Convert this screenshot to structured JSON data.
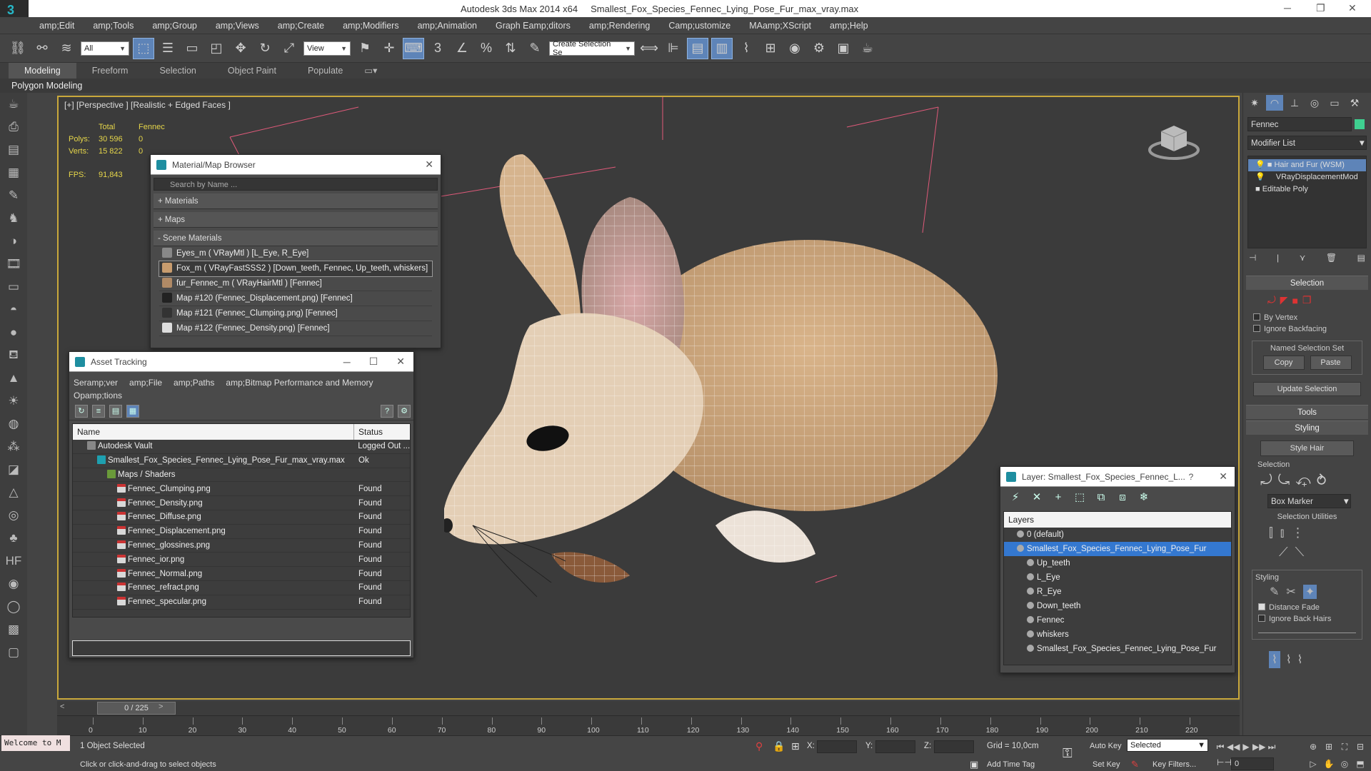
{
  "window": {
    "app_title": "Autodesk 3ds Max  2014 x64",
    "file_title": "Smallest_Fox_Species_Fennec_Lying_Pose_Fur_max_vray.max",
    "app_glyph": "3",
    "minimize": "─",
    "maximize": "❐",
    "close": "✕"
  },
  "menu": [
    "amp;Edit",
    "amp;Tools",
    "amp;Group",
    "amp;Views",
    "amp;Create",
    "amp;Modifiers",
    "amp;Animation",
    "Graph Eamp;ditors",
    "amp;Rendering",
    "Camp;ustomize",
    "MAamp;XScript",
    "amp;Help"
  ],
  "toolbar": {
    "filter_value": "All",
    "refcoord_value": "View",
    "selection_set_placeholder": "Create Selection Se"
  },
  "ribbon": {
    "tabs": [
      "Modeling",
      "Freeform",
      "Selection",
      "Object Paint",
      "Populate"
    ],
    "sub_label": "Polygon Modeling"
  },
  "viewport": {
    "label": "[+] [Perspective ] [Realistic + Edged Faces ]",
    "stats": {
      "head_total": "Total",
      "head_obj": "Fennec",
      "polys_label": "Polys:",
      "polys_total": "30 596",
      "polys_obj": "0",
      "verts_label": "Verts:",
      "verts_total": "15 822",
      "verts_obj": "0",
      "fps_label": "FPS:",
      "fps_value": "91,843"
    }
  },
  "material_browser": {
    "title": "Material/Map Browser",
    "search_placeholder": "Search by Name ...",
    "groups": [
      "+ Materials",
      "+ Maps",
      "- Scene Materials"
    ],
    "items": [
      "Eyes_m  ( VRayMtl ) [L_Eye, R_Eye]",
      "Fox_m  ( VRayFastSSS2 ) [Down_teeth, Fennec, Up_teeth, whiskers]",
      "fur_Fennec_m  ( VRayHairMtl ) [Fennec]",
      "Map #120 (Fennec_Displacement.png)  [Fennec]",
      "Map #121 (Fennec_Clumping.png)  [Fennec]",
      "Map #122 (Fennec_Density.png)  [Fennec]"
    ]
  },
  "asset_tracking": {
    "title": "Asset Tracking",
    "menu": [
      "Seramp;ver",
      "amp;File",
      "amp;Paths",
      "amp;Bitmap Performance and Memory"
    ],
    "menu2": "Opamp;tions",
    "col_name": "Name",
    "col_status": "Status",
    "rows": [
      {
        "name": "Autodesk Vault",
        "status": "Logged Out ...",
        "indent": 1,
        "icon": "vault"
      },
      {
        "name": "Smallest_Fox_Species_Fennec_Lying_Pose_Fur_max_vray.max",
        "status": "Ok",
        "indent": 2,
        "icon": "max"
      },
      {
        "name": "Maps / Shaders",
        "status": "",
        "indent": 3,
        "icon": "folder"
      },
      {
        "name": "Fennec_Clumping.png",
        "status": "Found",
        "indent": 4,
        "icon": "png"
      },
      {
        "name": "Fennec_Density.png",
        "status": "Found",
        "indent": 4,
        "icon": "png"
      },
      {
        "name": "Fennec_Diffuse.png",
        "status": "Found",
        "indent": 4,
        "icon": "png"
      },
      {
        "name": "Fennec_Displacement.png",
        "status": "Found",
        "indent": 4,
        "icon": "png"
      },
      {
        "name": "Fennec_glossines.png",
        "status": "Found",
        "indent": 4,
        "icon": "png"
      },
      {
        "name": "Fennec_ior.png",
        "status": "Found",
        "indent": 4,
        "icon": "png"
      },
      {
        "name": "Fennec_Normal.png",
        "status": "Found",
        "indent": 4,
        "icon": "png"
      },
      {
        "name": "Fennec_refract.png",
        "status": "Found",
        "indent": 4,
        "icon": "png"
      },
      {
        "name": "Fennec_specular.png",
        "status": "Found",
        "indent": 4,
        "icon": "png"
      }
    ]
  },
  "layer_panel": {
    "title": "Layer: Smallest_Fox_Species_Fennec_L...",
    "help": "?",
    "col": "Layers",
    "rows": [
      {
        "name": "0 (default)",
        "indent": 1,
        "selected": false
      },
      {
        "name": "Smallest_Fox_Species_Fennec_Lying_Pose_Fur",
        "indent": 1,
        "selected": true
      },
      {
        "name": "Up_teeth",
        "indent": 2,
        "selected": false
      },
      {
        "name": "L_Eye",
        "indent": 2,
        "selected": false
      },
      {
        "name": "R_Eye",
        "indent": 2,
        "selected": false
      },
      {
        "name": "Down_teeth",
        "indent": 2,
        "selected": false
      },
      {
        "name": "Fennec",
        "indent": 2,
        "selected": false
      },
      {
        "name": "whiskers",
        "indent": 2,
        "selected": false
      },
      {
        "name": "Smallest_Fox_Species_Fennec_Lying_Pose_Fur",
        "indent": 2,
        "selected": false
      }
    ]
  },
  "command_panel": {
    "object_name": "Fennec",
    "modifier_list": "Modifier List",
    "stack": [
      "Hair and Fur (WSM)",
      "VRayDisplacementMod",
      "Editable Poly"
    ],
    "selection_title": "Selection",
    "by_vertex": "By Vertex",
    "ignore_backfacing": "Ignore Backfacing",
    "named_sel_title": "Named Selection Set",
    "copy": "Copy",
    "paste": "Paste",
    "update_selection": "Update Selection",
    "tools": "Tools",
    "styling": "Styling",
    "style_hair": "Style Hair",
    "selection_sub": "Selection",
    "box_marker": "Box Marker",
    "selection_utilities": "Selection Utilities",
    "styling_sub": "Styling",
    "distance_fade": "Distance Fade",
    "ignore_back_hairs": "Ignore Back Hairs"
  },
  "timeline": {
    "frame": "0 / 225",
    "ticks": [
      "0",
      "10",
      "20",
      "30",
      "40",
      "50",
      "60",
      "70",
      "80",
      "90",
      "100",
      "110",
      "120",
      "130",
      "140",
      "150",
      "160",
      "170",
      "180",
      "190",
      "200",
      "210",
      "220"
    ]
  },
  "status": {
    "welcome": "Welcome to M",
    "objects_selected": "1 Object Selected",
    "prompt": "Click or click-and-drag to select objects",
    "x_label": "X:",
    "y_label": "Y:",
    "z_label": "Z:",
    "grid": "Grid = 10,0cm",
    "add_time_tag": "Add Time Tag",
    "auto_key": "Auto Key",
    "set_key": "Set Key",
    "key_mode": "Selected",
    "key_filters": "Key Filters...",
    "frame_field": "0"
  }
}
